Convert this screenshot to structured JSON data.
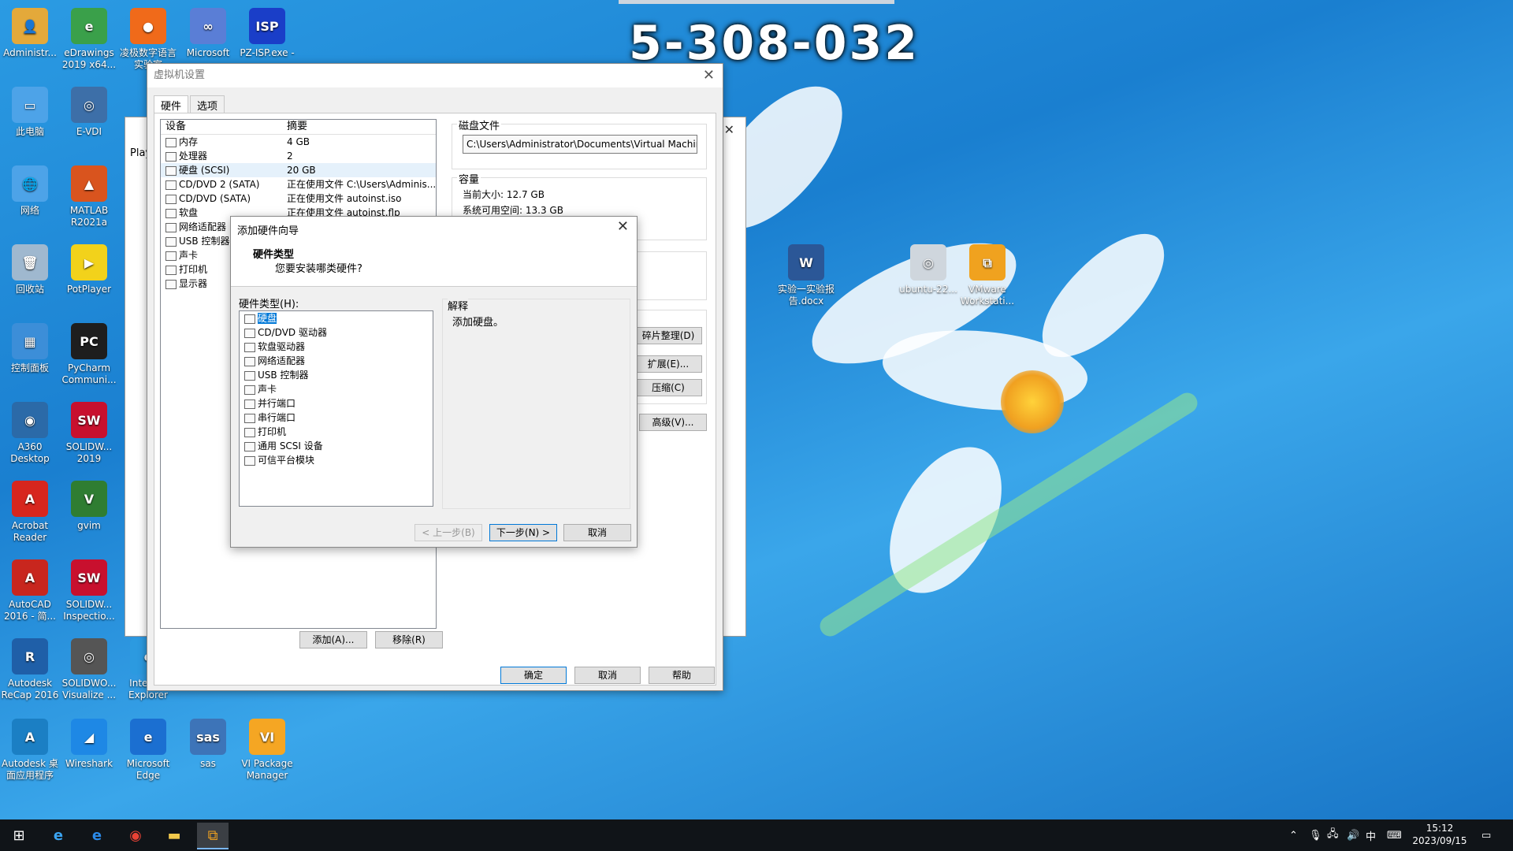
{
  "overlay_number": "5-308-032",
  "desktop_icons": [
    {
      "label": "Administr...",
      "icon": "user-folder-icon",
      "color": "#e4a93a",
      "glyph": "👤"
    },
    {
      "label": "eDrawings\n2019 x64...",
      "icon": "edrawings-icon",
      "color": "#3aa04a",
      "glyph": "e"
    },
    {
      "label": "凌极数字语言\n实验室",
      "icon": "ball-icon",
      "color": "#f06a1a",
      "glyph": "●"
    },
    {
      "label": "Microsoft",
      "icon": "microsoft-icon",
      "color": "#5a7ed6",
      "glyph": "∞"
    },
    {
      "label": "PZ-ISP.exe -",
      "icon": "pz-isp-icon",
      "color": "#1a3ec8",
      "glyph": "ISP"
    },
    {
      "label": "此电脑",
      "icon": "computer-icon",
      "color": "#4da3e8",
      "glyph": "▭"
    },
    {
      "label": "E-VDI",
      "icon": "evdi-icon",
      "color": "#3d6fa8",
      "glyph": "◎"
    },
    {
      "label": "网络",
      "icon": "network-icon",
      "color": "#4da3e8",
      "glyph": "🌐"
    },
    {
      "label": "MATLAB\nR2021a",
      "icon": "matlab-icon",
      "color": "#d9541e",
      "glyph": "▲"
    },
    {
      "label": "回收站",
      "icon": "recycle-bin-icon",
      "color": "#9fb8cf",
      "glyph": "🗑"
    },
    {
      "label": "PotPlayer",
      "icon": "potplayer-icon",
      "color": "#f2d21b",
      "glyph": "▶"
    },
    {
      "label": "控制面板",
      "icon": "control-panel-icon",
      "color": "#3c8ed8",
      "glyph": "▦"
    },
    {
      "label": "PyCharm\nCommuni...",
      "icon": "pycharm-icon",
      "color": "#1e1e1e",
      "glyph": "PC"
    },
    {
      "label": "A360\nDesktop",
      "icon": "a360-icon",
      "color": "#2b6aa8",
      "glyph": "◉"
    },
    {
      "label": "SOLIDW...\n2019",
      "icon": "solidworks-icon",
      "color": "#c8102e",
      "glyph": "SW"
    },
    {
      "label": "Acrobat\nReader",
      "icon": "acrobat-icon",
      "color": "#d7261e",
      "glyph": "A"
    },
    {
      "label": "gvim",
      "icon": "gvim-icon",
      "color": "#2f7d32",
      "glyph": "V"
    },
    {
      "label": "AutoCAD\n2016 - 简...",
      "icon": "autocad-icon",
      "color": "#c8261e",
      "glyph": "A"
    },
    {
      "label": "SOLIDW...\nInspectio...",
      "icon": "solidworks-inspection-icon",
      "color": "#c8102e",
      "glyph": "SW"
    },
    {
      "label": "Autodesk\nReCap 2016",
      "icon": "recap-icon",
      "color": "#1f5fa8",
      "glyph": "R"
    },
    {
      "label": "SOLIDWO...\nVisualize ...",
      "icon": "visualize-icon",
      "color": "#555",
      "glyph": "◎"
    },
    {
      "label": "Internet\nExplorer",
      "icon": "ie-icon",
      "color": "#2c9ae0",
      "glyph": "e"
    },
    {
      "label": "Autodesk 桌\n面应用程序",
      "icon": "autodesk-icon",
      "color": "#1b7fc4",
      "glyph": "A"
    },
    {
      "label": "Wireshark",
      "icon": "wireshark-icon",
      "color": "#1e88e5",
      "glyph": "◢"
    },
    {
      "label": "Microsoft\nEdge",
      "icon": "edge-icon",
      "color": "#1b6fd1",
      "glyph": "e"
    },
    {
      "label": "sas",
      "icon": "sas-icon",
      "color": "#3d74b8",
      "glyph": "sas"
    },
    {
      "label": "VI Package\nManager",
      "icon": "vipm-icon",
      "color": "#f5a623",
      "glyph": "VI"
    },
    {
      "label": "实验一实验报\n告.docx",
      "icon": "word-doc-icon",
      "color": "#2b5797",
      "glyph": "W"
    },
    {
      "label": "ubuntu-22...",
      "icon": "disc-image-icon",
      "color": "#cfd6dd",
      "glyph": "◎"
    },
    {
      "label": "VMware\nWorkstati...",
      "icon": "vmware-icon",
      "color": "#f0a21f",
      "glyph": "⧉"
    }
  ],
  "background_window": {
    "play_label": "Play"
  },
  "settings_window": {
    "title": "虚拟机设置",
    "tabs": [
      "硬件",
      "选项"
    ],
    "columns": {
      "device": "设备",
      "summary": "摘要"
    },
    "devices": [
      {
        "name": "内存",
        "summary": "4 GB"
      },
      {
        "name": "处理器",
        "summary": "2"
      },
      {
        "name": "硬盘 (SCSI)",
        "summary": "20 GB"
      },
      {
        "name": "CD/DVD 2 (SATA)",
        "summary": "正在使用文件 C:\\Users\\Adminis..."
      },
      {
        "name": "CD/DVD (SATA)",
        "summary": "正在使用文件 autoinst.iso"
      },
      {
        "name": "软盘",
        "summary": "正在使用文件 autoinst.flp"
      },
      {
        "name": "网络适配器",
        "summary": ""
      },
      {
        "name": "USB 控制器",
        "summary": ""
      },
      {
        "name": "声卡",
        "summary": ""
      },
      {
        "name": "打印机",
        "summary": ""
      },
      {
        "name": "显示器",
        "summary": ""
      }
    ],
    "disk_file_label": "磁盘文件",
    "disk_file_path": "C:\\Users\\Administrator\\Documents\\Virtual Machines\\",
    "capacity_label": "容量",
    "current_size": "当前大小: 12.7 GB",
    "system_free": "系统可用空间: 13.3 GB",
    "defrag_button": "碎片整理(D)",
    "expand_button": "扩展(E)...",
    "compact_button": "压缩(C)",
    "advanced_button": "高级(V)...",
    "add_button": "添加(A)...",
    "remove_button": "移除(R)",
    "ok_button": "确定",
    "cancel_button": "取消",
    "help_button": "帮助"
  },
  "wizard": {
    "title": "添加硬件向导",
    "heading": "硬件类型",
    "subheading": "您要安装哪类硬件?",
    "list_label": "硬件类型(H):",
    "items": [
      "硬盘",
      "CD/DVD 驱动器",
      "软盘驱动器",
      "网络适配器",
      "USB 控制器",
      "声卡",
      "并行端口",
      "串行端口",
      "打印机",
      "通用 SCSI 设备",
      "可信平台模块"
    ],
    "explain_label": "解释",
    "explain_text": "添加硬盘。",
    "back_button": "< 上一步(B)",
    "next_button": "下一步(N) >",
    "cancel_button": "取消"
  },
  "taskbar": {
    "ime": "中",
    "time": "15:12",
    "date": "2023/09/15"
  }
}
